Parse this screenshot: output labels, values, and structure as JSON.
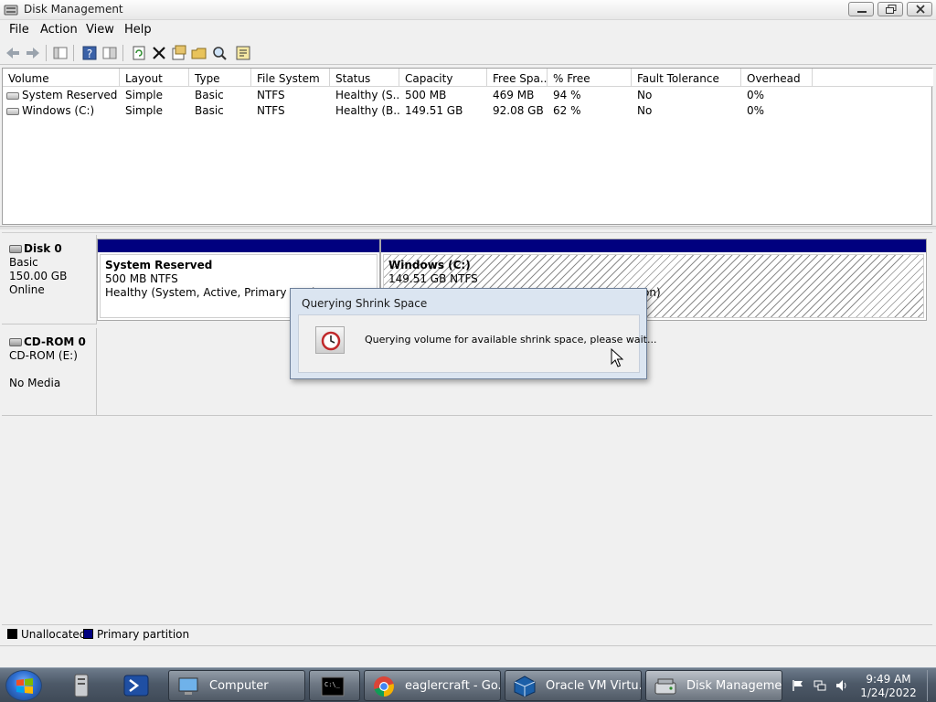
{
  "window": {
    "title": "Disk Management"
  },
  "menu": [
    "File",
    "Action",
    "View",
    "Help"
  ],
  "toolbar": {
    "icons": [
      "back-icon",
      "forward-icon",
      "properties-pane-icon",
      "help-icon",
      "show-hide-icon",
      "refresh-icon",
      "delete-icon",
      "properties-icon",
      "open-icon",
      "explore-icon",
      "more-icon"
    ]
  },
  "volume_table": {
    "columns": [
      "Volume",
      "Layout",
      "Type",
      "File System",
      "Status",
      "Capacity",
      "Free Spa...",
      "% Free",
      "Fault Tolerance",
      "Overhead"
    ],
    "rows": [
      [
        "System Reserved",
        "Simple",
        "Basic",
        "NTFS",
        "Healthy (S...",
        "500 MB",
        "469 MB",
        "94 %",
        "No",
        "0%"
      ],
      [
        "Windows (C:)",
        "Simple",
        "Basic",
        "NTFS",
        "Healthy (B...",
        "149.51 GB",
        "92.08 GB",
        "62 %",
        "No",
        "0%"
      ]
    ]
  },
  "disks": [
    {
      "name": "Disk 0",
      "lines": [
        "Basic",
        "150.00 GB",
        "Online"
      ],
      "partitions": [
        {
          "name": "System Reserved",
          "size": "500 MB NTFS",
          "status": "Healthy (System, Active, Primary Partit"
        },
        {
          "name": "Windows  (C:)",
          "size": "149.51 GB NTFS",
          "status": "on)"
        }
      ]
    },
    {
      "name": "CD-ROM 0",
      "lines": [
        "CD-ROM (E:)",
        "",
        "No Media"
      ]
    }
  ],
  "legend": [
    {
      "label": "Unallocated",
      "color": "#000000"
    },
    {
      "label": "Primary partition",
      "color": "#00007f"
    }
  ],
  "dialog": {
    "title": "Querying Shrink Space",
    "message": "Querying volume for available shrink space, please wait..."
  },
  "taskbar": {
    "tasks": [
      {
        "label": "Computer",
        "icon": "computer-icon"
      },
      {
        "label": "",
        "icon": "cmd-icon"
      },
      {
        "label": "eaglercraft - Go...",
        "icon": "chrome-icon"
      },
      {
        "label": "Oracle VM Virtu...",
        "icon": "virtualbox-icon"
      },
      {
        "label": "Disk Management",
        "icon": "disk-management-icon"
      }
    ],
    "clock": {
      "time": "9:49 AM",
      "date": "1/24/2022"
    }
  }
}
